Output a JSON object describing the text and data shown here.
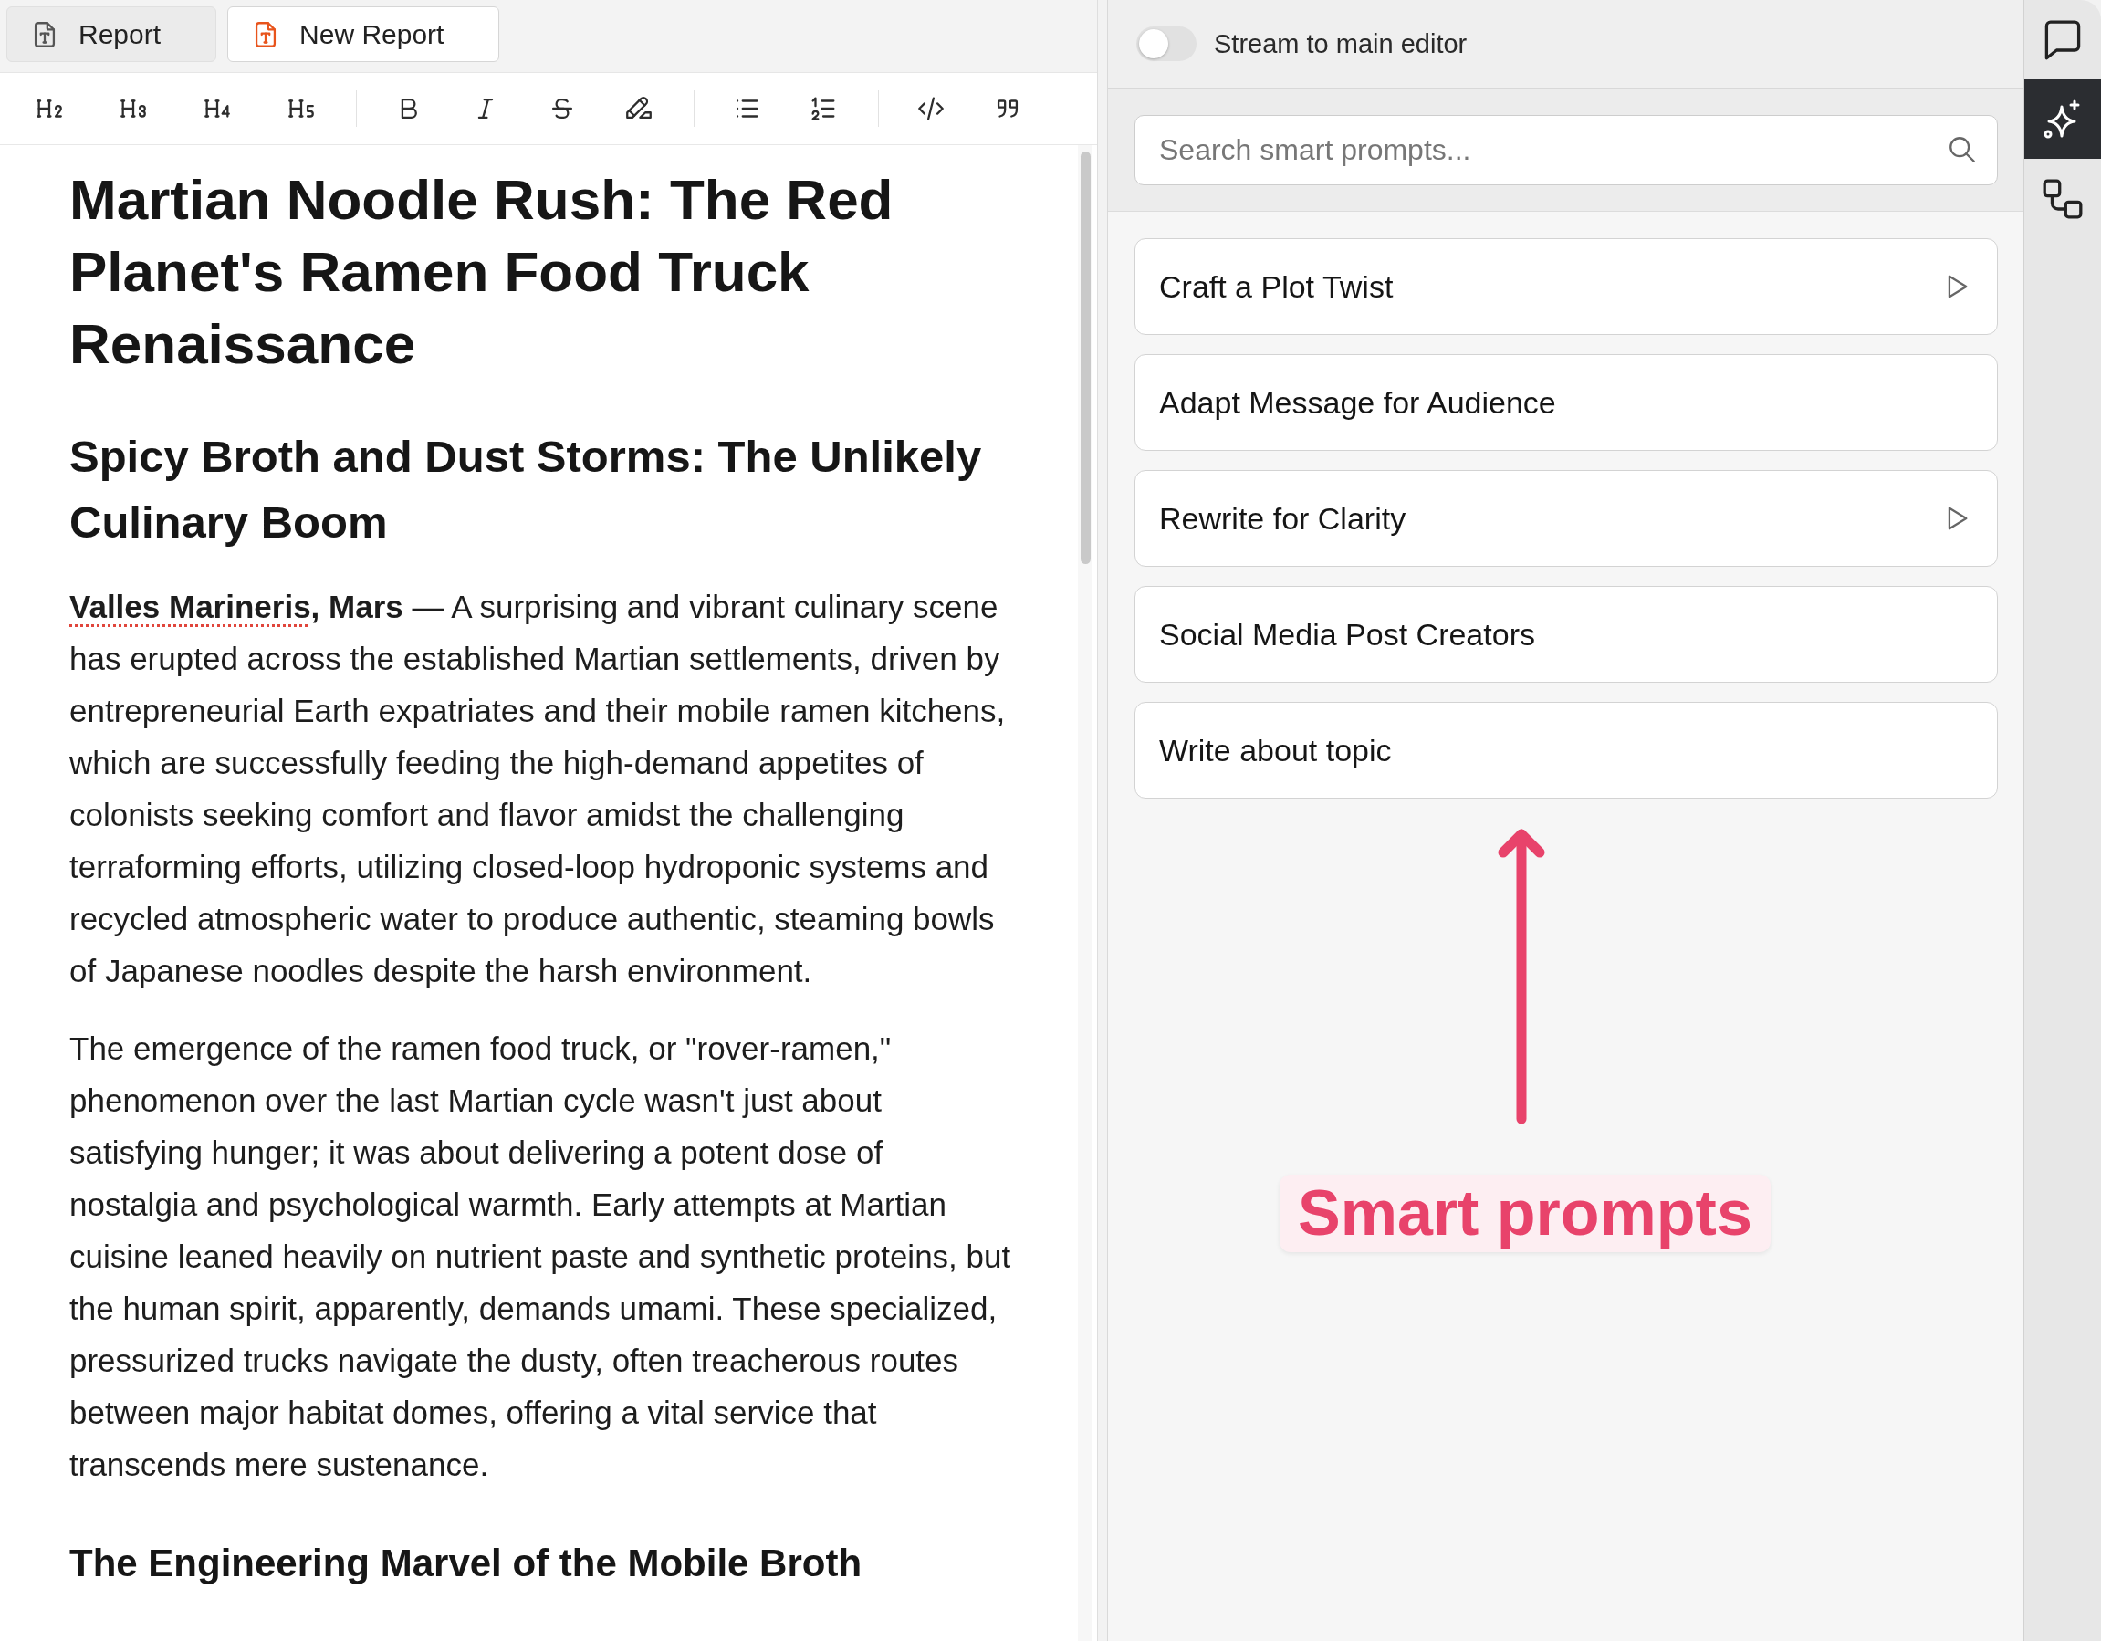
{
  "tabs": [
    {
      "label": "Report",
      "selected": false
    },
    {
      "label": "New Report",
      "selected": true
    }
  ],
  "document": {
    "blocks": [
      {
        "kind": "title",
        "text": "Martian Noodle Rush: The Red Planet's Ramen Food Truck Renaissance"
      },
      {
        "kind": "heading",
        "text": "Spicy Broth and Dust Storms: The Unlikely Culinary Boom"
      },
      {
        "kind": "paragraph",
        "runs": [
          {
            "text": "Valles Marineris",
            "bold": true,
            "misspelled": true
          },
          {
            "text": ", Mars",
            "bold": true,
            "misspelled": false
          },
          {
            "text": " — A surprising and vibrant culinary scene has erupted across the established Martian settlements, driven by entrepreneurial Earth expatriates and their mobile ramen kitchens, which are successfully feeding the high-demand appetites of colonists seeking comfort and flavor amidst the challenging terraforming efforts, utilizing closed-loop hydroponic systems and recycled atmospheric water to produce authentic, steaming bowls of Japanese noodles despite the harsh environment.",
            "bold": false,
            "misspelled": false
          }
        ]
      },
      {
        "kind": "paragraph",
        "runs": [
          {
            "text": "The emergence of the ramen food truck, or \"rover-ramen,\" phenomenon over the last Martian cycle wasn't just about satisfying hunger; it was about delivering a potent dose of nostalgia and psychological warmth. Early attempts at Martian cuisine leaned heavily on nutrient paste and synthetic proteins, but the human spirit, apparently, demands umami. These specialized, pressurized trucks navigate the dusty, often treacherous routes between major habitat domes, offering a vital service that transcends mere sustenance.",
            "bold": false,
            "misspelled": false
          }
        ]
      },
      {
        "kind": "subheading",
        "text": "The Engineering Marvel of the Mobile Broth"
      }
    ]
  },
  "stream_toggle": {
    "label": "Stream to main editor",
    "on": false
  },
  "search": {
    "placeholder": "Search smart prompts..."
  },
  "prompts": [
    {
      "label": "Craft a Plot Twist",
      "runnable": true
    },
    {
      "label": "Adapt Message for Audience",
      "runnable": false
    },
    {
      "label": "Rewrite for Clarity",
      "runnable": true
    },
    {
      "label": "Social Media Post Creators",
      "runnable": false
    },
    {
      "label": "Write about topic",
      "runnable": false
    }
  ],
  "annotation": {
    "label": "Smart prompts"
  },
  "rail": [
    {
      "kind": "chat",
      "selected": false
    },
    {
      "kind": "prompts",
      "selected": true
    },
    {
      "kind": "connections",
      "selected": false
    }
  ]
}
